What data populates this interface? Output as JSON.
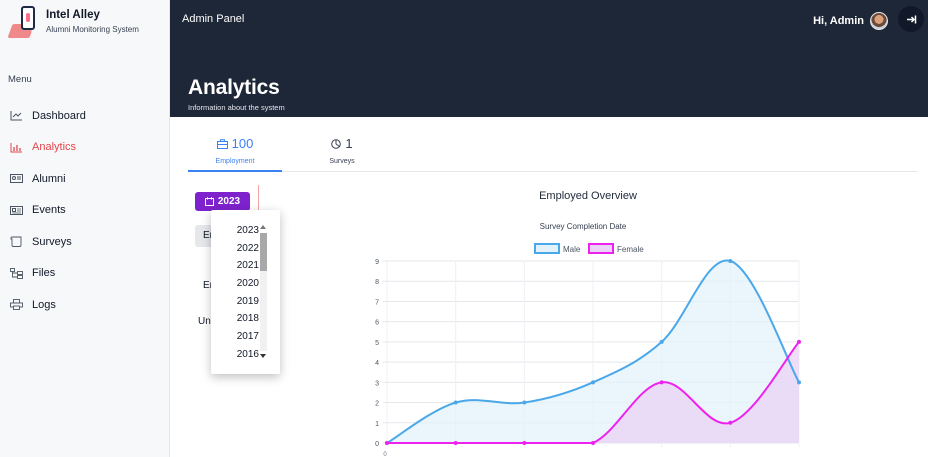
{
  "brand": {
    "title": "Intel Alley",
    "subtitle": "Alumni Monitoring System"
  },
  "sidebar": {
    "menu_heading": "Menu",
    "items": [
      {
        "label": "Dashboard",
        "icon": "line-chart-icon",
        "active": false
      },
      {
        "label": "Analytics",
        "icon": "bar-chart-icon",
        "active": true
      },
      {
        "label": "Alumni",
        "icon": "id-card-icon",
        "active": false
      },
      {
        "label": "Events",
        "icon": "newspaper-icon",
        "active": false
      },
      {
        "label": "Surveys",
        "icon": "scroll-icon",
        "active": false
      },
      {
        "label": "Files",
        "icon": "folder-tree-icon",
        "active": false
      },
      {
        "label": "Logs",
        "icon": "printer-icon",
        "active": false
      }
    ]
  },
  "header": {
    "panel_title": "Admin Panel",
    "greeting": "Hi, Admin",
    "page_title": "Analytics",
    "page_subtitle": "Information about the system"
  },
  "tabs": [
    {
      "count": "100",
      "label": "Employment",
      "icon": "briefcase-icon",
      "active": true
    },
    {
      "count": "1",
      "label": "Surveys",
      "icon": "pie-chart-icon",
      "active": false
    }
  ],
  "controls": {
    "year_button": "2023",
    "filter_chip": "Em",
    "side_text_1": "Em",
    "side_text_2": "Une"
  },
  "year_dropdown": {
    "options": [
      "2023",
      "2022",
      "2021",
      "2020",
      "2019",
      "2018",
      "2017",
      "2016"
    ]
  },
  "colors": {
    "accent_active": "#e0474c",
    "tab_active": "#3b82f6",
    "year_button": "#7e22ce",
    "header_bg": "#1e2738",
    "male_series": "#4aa8ea",
    "female_series": "#ee22ee"
  },
  "chart_data": {
    "type": "area",
    "title": "Employed Overview",
    "subtitle": "Survey Completion Date",
    "ylim": [
      0,
      9
    ],
    "y_ticks": [
      "0",
      "1",
      "2",
      "3",
      "4",
      "5",
      "6",
      "7",
      "8",
      "9"
    ],
    "x": [
      0,
      1,
      2,
      3,
      4,
      5,
      6
    ],
    "x_tick_labels": [
      "0",
      "",
      "",
      "",
      "",
      "",
      ""
    ],
    "grid": true,
    "legend_placement": "top-center",
    "series": [
      {
        "name": "Male",
        "values": [
          0,
          2,
          2,
          3,
          5,
          9,
          3
        ],
        "color": "#4aa8ea",
        "fill": "#e3f1fb"
      },
      {
        "name": "Female",
        "values": [
          0,
          0,
          0,
          0,
          3,
          1,
          5
        ],
        "color": "#ee22ee",
        "fill": "#ead3f6"
      }
    ]
  }
}
